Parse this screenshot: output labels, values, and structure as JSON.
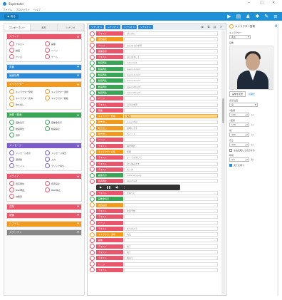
{
  "app": {
    "title": "Supertutor",
    "menu": [
      "ファイル",
      "プロジェクト",
      "ヘルプ"
    ],
    "toolbar_button": "戻る"
  },
  "left": {
    "tabs": [
      "コンポーネント",
      "素材",
      "シナリオ"
    ],
    "categories": [
      {
        "title": "スライド",
        "color": "#e9556b",
        "items": [
          {
            "label": "テキスト",
            "color": "#e9556b"
          },
          {
            "label": "画像",
            "color": "#e9556b"
          },
          {
            "label": "動画",
            "color": "#e9556b"
          },
          {
            "label": "ページ",
            "color": "#e9556b"
          },
          {
            "label": "クイズ",
            "color": "#e9556b"
          },
          {
            "label": "ゲーム",
            "color": "#e9556b"
          }
        ]
      },
      {
        "title": "背景",
        "color": "#2a8ad8",
        "items": []
      },
      {
        "title": "画面効果",
        "color": "#2a8ad8",
        "items": []
      },
      {
        "title": "キャラクター",
        "color": "#f29a1e",
        "items": [
          {
            "label": "キャラクター登場",
            "color": "#f29a1e"
          },
          {
            "label": "キャラクター退場",
            "color": "#f29a1e"
          },
          {
            "label": "キャラクター表情",
            "color": "#f29a1e"
          },
          {
            "label": "キャラクター移動",
            "color": "#f29a1e"
          },
          {
            "label": "吹き出し",
            "color": "#f29a1e"
          }
        ]
      },
      {
        "title": "画像・動画",
        "color": "#3aa655",
        "items": [
          {
            "label": "画像表示",
            "color": "#3aa655"
          },
          {
            "label": "画像非表示",
            "color": "#3aa655"
          },
          {
            "label": "動画再生",
            "color": "#3aa655"
          },
          {
            "label": "動画停止",
            "color": "#3aa655"
          },
          {
            "label": "音声",
            "color": "#3aa655"
          }
        ]
      },
      {
        "title": "メッセージ",
        "color": "#7b5cc9",
        "items": [
          {
            "label": "メッセージ表示",
            "color": "#7b5cc9"
          },
          {
            "label": "メッセージ消去",
            "color": "#7b5cc9"
          },
          {
            "label": "選択肢",
            "color": "#7b5cc9"
          },
          {
            "label": "入力",
            "color": "#7b5cc9"
          },
          {
            "label": "ウェイト",
            "color": "#7b5cc9"
          },
          {
            "label": "クリック待ち",
            "color": "#7b5cc9"
          }
        ]
      },
      {
        "title": "メディア",
        "color": "#e9556b",
        "items": [
          {
            "label": "音声再生",
            "color": "#e9556b"
          },
          {
            "label": "音声停止",
            "color": "#e9556b"
          },
          {
            "label": "BGM再生",
            "color": "#e9556b"
          },
          {
            "label": "BGM停止",
            "color": "#e9556b"
          },
          {
            "label": "効果音",
            "color": "#e9556b"
          }
        ]
      },
      {
        "title": "変数",
        "color": "#e9556b",
        "items": []
      },
      {
        "title": "制御",
        "color": "#e9556b",
        "items": []
      },
      {
        "title": "システム",
        "color": "#f29a1e",
        "items": []
      },
      {
        "title": "スクリプト",
        "color": "#888888",
        "items": []
      }
    ]
  },
  "middle": {
    "tabs": [
      "シナリオ 1",
      "シナリオ 2",
      "シナリオ 3",
      "シナリオ 4"
    ],
    "rows": [
      {
        "label": "テキスト",
        "color": "#e9556b",
        "value": "はじめに"
      },
      {
        "label": "変数設定",
        "color": "#f29a1e",
        "value": ""
      },
      {
        "label": "ページ",
        "color": "#e9556b",
        "value": "はじめての学習"
      },
      {
        "label": "画像表示",
        "color": "#e9556b",
        "value": ""
      },
      {
        "label": "テキスト",
        "color": "#e9556b",
        "value": "はじめまして"
      },
      {
        "label": "動画再生",
        "color": "#3aa655",
        "value": "intro.mp4"
      },
      {
        "label": "動画再生",
        "color": "#3aa655",
        "value": "lesson1.mp4"
      },
      {
        "label": "動画再生",
        "color": "#3aa655",
        "value": "lesson2.mp4"
      },
      {
        "label": "動画再生",
        "color": "#3aa655",
        "value": "lesson3.mp4"
      },
      {
        "label": "動画再生",
        "color": "#3aa655",
        "value": "lesson4.mp4"
      },
      {
        "label": "動画再生",
        "color": "#3aa655",
        "value": "lesson5.mp4"
      },
      {
        "label": "ページ",
        "color": "#e9556b",
        "value": ""
      },
      {
        "label": "テキスト",
        "color": "#e9556b",
        "value": "今日の学習"
      },
      {
        "label": "画像",
        "color": "#e9556b",
        "value": ""
      },
      {
        "label": "キャラクター登場",
        "color": "#f29a1e",
        "value": "先生",
        "highlight": true
      },
      {
        "label": "吹き出し",
        "color": "#f29a1e",
        "value": "こんにちは"
      },
      {
        "label": "吹き出し",
        "color": "#f29a1e",
        "value": "説明します"
      },
      {
        "label": "吹き出し",
        "color": "#f29a1e",
        "value": "ポイント"
      },
      {
        "label": "ページ",
        "color": "#e9556b",
        "value": ""
      },
      {
        "label": "テキスト",
        "color": "#e9556b",
        "value": "練習問題"
      },
      {
        "label": "キャラクター表情",
        "color": "#f29a1e",
        "value": "笑顔"
      },
      {
        "label": "テキスト",
        "color": "#e9556b",
        "value": "よくできました"
      },
      {
        "label": "テキスト",
        "color": "#e9556b",
        "value": "次へ進みます"
      },
      {
        "label": "テキスト",
        "color": "#e9556b",
        "value": "まとめ"
      },
      {
        "label": "画像表示",
        "color": "#3aa655",
        "value": "summary.png"
      },
      {
        "label": "音声再生",
        "color": "#e9556b",
        "value": "bgm.mp3"
      },
      {
        "label": "AUDIO",
        "color": "",
        "value": ""
      },
      {
        "label": "テキスト",
        "color": "#e9556b",
        "value": "おわりに"
      },
      {
        "label": "画像非表示",
        "color": "#3aa655",
        "value": ""
      },
      {
        "label": "変数設定",
        "color": "#f29a1e",
        "value": ""
      },
      {
        "label": "テキスト",
        "color": "#e9556b",
        "value": "次回予告"
      },
      {
        "label": "テキスト",
        "color": "#e9556b",
        "value": ""
      },
      {
        "label": "ページ",
        "color": "#e9556b",
        "value": ""
      },
      {
        "label": "テキスト",
        "color": "#e9556b",
        "value": "ありがとう"
      },
      {
        "label": "キャラクター退場",
        "color": "#f29a1e",
        "value": "先生"
      },
      {
        "label": "画像",
        "color": "#e9556b",
        "value": ""
      },
      {
        "label": "テキスト",
        "color": "#e9556b",
        "value": "終了"
      },
      {
        "label": "テキスト",
        "color": "#e9556b",
        "value": "完了"
      },
      {
        "label": "テキスト",
        "color": "#e9556b",
        "value": "終わり"
      },
      {
        "label": "ページ",
        "color": "#e9556b",
        "value": ""
      },
      {
        "label": "テキスト",
        "color": "#e9556b",
        "value": ""
      }
    ]
  },
  "right": {
    "title": "キャラクター登場",
    "character_label": "キャラクター",
    "character_value": "先生",
    "image_label": "画像",
    "change_button": "画像を変更",
    "link_label": "初期化",
    "position_label": "表示位置",
    "position_value": "左",
    "fields": [
      {
        "label": "X座標",
        "value": "100",
        "unit": "px"
      },
      {
        "label": "Y座標",
        "value": "178",
        "unit": "px"
      },
      {
        "label": "幅",
        "value": "400",
        "unit": "px"
      },
      {
        "label": "高さ",
        "value": "400",
        "unit": "px"
      }
    ],
    "check1": "左右反転して表示する",
    "time_label": "時間",
    "time_value": "0.5",
    "time_unit": "秒",
    "check2": "完了を待つ"
  }
}
